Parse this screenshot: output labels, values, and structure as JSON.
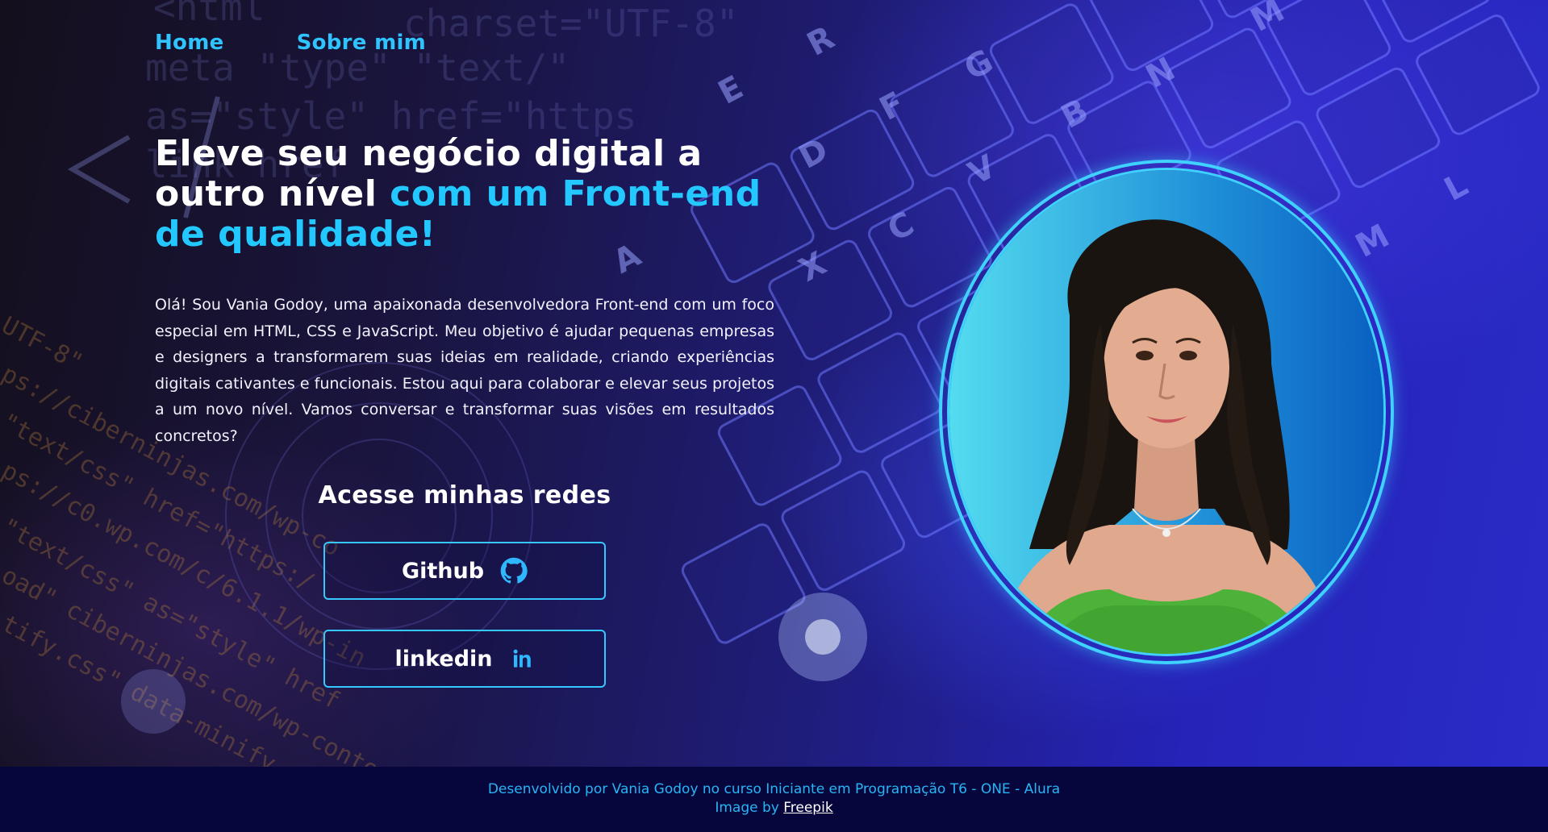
{
  "nav": {
    "home": "Home",
    "about": "Sobre mim"
  },
  "headline": {
    "part1": "Eleve seu negócio digital a outro nível",
    "part2": " com um Front-end de qualidade!"
  },
  "intro": "Olá! Sou Vania Godoy, uma apaixonada desenvolvedora Front-end com um foco especial em HTML, CSS e JavaScript. Meu objetivo é ajudar pequenas empresas e designers a transformarem suas ideias em realidade, criando experiências digitais cativantes e funcionais. Estou aqui para colaborar e elevar seus projetos a um novo nível. Vamos conversar e transformar suas visões em resultados concretos?",
  "networks": {
    "title": "Acesse minhas redes",
    "github": {
      "label": "Github",
      "icon": "github-icon"
    },
    "linkedin": {
      "label": "linkedin",
      "icon": "linkedin-icon"
    }
  },
  "photo": {
    "alt": ""
  },
  "footer": {
    "line1": "Desenvolvido por Vania Godoy no curso Iniciante em Programação T6 - ONE - Alura",
    "line2_prefix": "Image by ",
    "line2_credit": "Freepik"
  },
  "colors": {
    "accent": "#22c8ff",
    "footer_bg": "#06063d",
    "ring": "#3fd2ff"
  }
}
